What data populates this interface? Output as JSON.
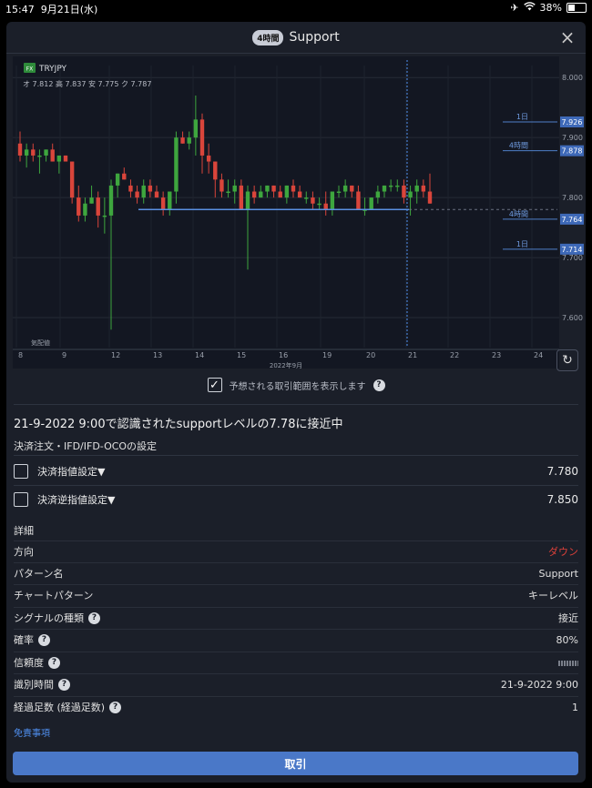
{
  "status": {
    "time": "15:47",
    "date": "9月21日(水)",
    "battery": "38%",
    "battery_level": 0.38
  },
  "dialog": {
    "timeframe_badge": "4時間",
    "title": "Support"
  },
  "chart": {
    "symbol_badge": "FX",
    "symbol": "TRYJPY",
    "ohlc": "オ 7.812  高 7.837  安 7.775  ク 7.787",
    "quote_label": "気配値",
    "month_label": "2022年9月",
    "y_ticks": [
      "8.000",
      "7.900",
      "7.800",
      "7.700",
      "7.600"
    ],
    "x_ticks": [
      "8",
      "9",
      "12",
      "13",
      "14",
      "15",
      "16",
      "19",
      "20",
      "21",
      "22",
      "23",
      "24"
    ],
    "markers": [
      {
        "label": "1日",
        "value": "7.926"
      },
      {
        "label": "4時間",
        "value": "7.878"
      },
      {
        "label": "4時間",
        "value": "7.764"
      },
      {
        "label": "1日",
        "value": "7.714"
      }
    ],
    "support_level": 7.78
  },
  "chart_data": {
    "type": "candlestick",
    "symbol": "TRYJPY",
    "ylim": [
      7.55,
      8.02
    ],
    "y_ticks": [
      8.0,
      7.9,
      7.8,
      7.7,
      7.6
    ],
    "x_ticks": [
      "8",
      "9",
      "12",
      "13",
      "14",
      "15",
      "16",
      "19",
      "20",
      "21",
      "22",
      "23",
      "24"
    ],
    "support": 7.78,
    "candles": [
      [
        7.89,
        7.91,
        7.86,
        7.87
      ],
      [
        7.87,
        7.89,
        7.85,
        7.88
      ],
      [
        7.88,
        7.89,
        7.86,
        7.87
      ],
      [
        7.87,
        7.88,
        7.84,
        7.87
      ],
      [
        7.87,
        7.88,
        7.86,
        7.88
      ],
      [
        7.88,
        7.89,
        7.86,
        7.86
      ],
      [
        7.86,
        7.87,
        7.84,
        7.87
      ],
      [
        7.87,
        7.87,
        7.86,
        7.86
      ],
      [
        7.86,
        7.86,
        7.79,
        7.8
      ],
      [
        7.8,
        7.82,
        7.76,
        7.77
      ],
      [
        7.77,
        7.8,
        7.76,
        7.79
      ],
      [
        7.79,
        7.82,
        7.79,
        7.8
      ],
      [
        7.8,
        7.81,
        7.75,
        7.77
      ],
      [
        7.77,
        7.8,
        7.74,
        7.77
      ],
      [
        7.77,
        7.83,
        7.58,
        7.82
      ],
      [
        7.82,
        7.84,
        7.8,
        7.84
      ],
      [
        7.84,
        7.85,
        7.83,
        7.83
      ],
      [
        7.82,
        7.83,
        7.8,
        7.81
      ],
      [
        7.81,
        7.82,
        7.79,
        7.8
      ],
      [
        7.8,
        7.83,
        7.79,
        7.82
      ],
      [
        7.82,
        7.83,
        7.8,
        7.81
      ],
      [
        7.81,
        7.82,
        7.8,
        7.8
      ],
      [
        7.8,
        7.81,
        7.77,
        7.78
      ],
      [
        7.78,
        7.81,
        7.77,
        7.81
      ],
      [
        7.81,
        7.91,
        7.79,
        7.9
      ],
      [
        7.9,
        7.91,
        7.89,
        7.89
      ],
      [
        7.89,
        7.91,
        7.88,
        7.9
      ],
      [
        7.9,
        7.97,
        7.87,
        7.93
      ],
      [
        7.93,
        7.94,
        7.84,
        7.87
      ],
      [
        7.87,
        7.89,
        7.84,
        7.86
      ],
      [
        7.86,
        7.86,
        7.8,
        7.83
      ],
      [
        7.83,
        7.84,
        7.8,
        7.81
      ],
      [
        7.81,
        7.83,
        7.8,
        7.81
      ],
      [
        7.81,
        7.83,
        7.79,
        7.82
      ],
      [
        7.82,
        7.83,
        7.78,
        7.78
      ],
      [
        7.78,
        7.82,
        7.68,
        7.81
      ],
      [
        7.81,
        7.82,
        7.79,
        7.8
      ],
      [
        7.8,
        7.82,
        7.8,
        7.81
      ],
      [
        7.81,
        7.82,
        7.8,
        7.82
      ],
      [
        7.82,
        7.82,
        7.8,
        7.81
      ],
      [
        7.81,
        7.82,
        7.8,
        7.8
      ],
      [
        7.8,
        7.82,
        7.79,
        7.82
      ],
      [
        7.82,
        7.83,
        7.8,
        7.81
      ],
      [
        7.81,
        7.82,
        7.8,
        7.8
      ],
      [
        7.8,
        7.81,
        7.79,
        7.8
      ],
      [
        7.8,
        7.81,
        7.78,
        7.79
      ],
      [
        7.79,
        7.8,
        7.78,
        7.79
      ],
      [
        7.79,
        7.81,
        7.77,
        7.78
      ],
      [
        7.78,
        7.81,
        7.77,
        7.81
      ],
      [
        7.81,
        7.82,
        7.8,
        7.81
      ],
      [
        7.81,
        7.83,
        7.8,
        7.82
      ],
      [
        7.82,
        7.82,
        7.8,
        7.81
      ],
      [
        7.81,
        7.82,
        7.78,
        7.78
      ],
      [
        7.78,
        7.8,
        7.77,
        7.78
      ],
      [
        7.78,
        7.8,
        7.78,
        7.8
      ],
      [
        7.8,
        7.82,
        7.79,
        7.81
      ],
      [
        7.81,
        7.82,
        7.8,
        7.82
      ],
      [
        7.82,
        7.83,
        7.81,
        7.82
      ],
      [
        7.82,
        7.83,
        7.81,
        7.82
      ],
      [
        7.82,
        7.83,
        7.79,
        7.8
      ],
      [
        7.8,
        7.82,
        7.77,
        7.81
      ],
      [
        7.81,
        7.83,
        7.79,
        7.82
      ],
      [
        7.82,
        7.83,
        7.8,
        7.81
      ],
      [
        7.81,
        7.84,
        7.79,
        7.79
      ]
    ]
  },
  "range_option": {
    "checked": true,
    "label": "予想される取引範囲を表示します"
  },
  "notice": "21-9-2022 9:00で認識されたsupportレベルの7.78に接近中",
  "order_section": {
    "title": "決済注文・IFD/IFD-OCOの設定",
    "items": [
      {
        "label": "決済指値設定▼",
        "value": "7.780",
        "checked": false
      },
      {
        "label": "決済逆指値設定▼",
        "value": "7.850",
        "checked": false
      }
    ]
  },
  "details": {
    "title": "詳細",
    "rows": [
      {
        "label": "方向",
        "value": "ダウン"
      },
      {
        "label": "パターン名",
        "value": "Support"
      },
      {
        "label": "チャートパターン",
        "value": "キーレベル"
      },
      {
        "label": "シグナルの種類",
        "value": "接近"
      },
      {
        "label": "確率",
        "value": "80%"
      },
      {
        "label": "信頼度",
        "value": ""
      },
      {
        "label": "識別時間",
        "value": "21-9-2022 9:00"
      },
      {
        "label": "経過足数 (経過足数)",
        "value": "1"
      }
    ]
  },
  "disclaimer": "免責事項",
  "trade_button": "取引"
}
